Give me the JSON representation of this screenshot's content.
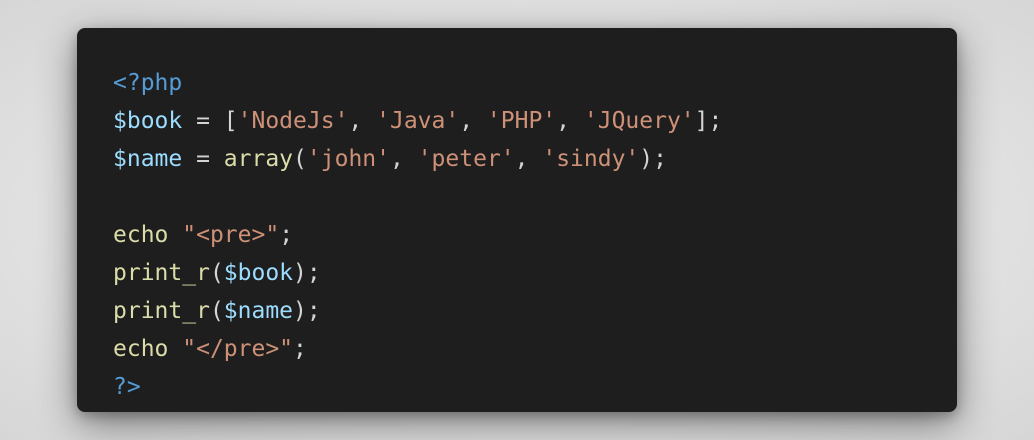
{
  "code": {
    "lines": [
      [
        {
          "t": "<?php",
          "k": "tag"
        }
      ],
      [
        {
          "t": "$book",
          "k": "var"
        },
        {
          "t": " = [",
          "k": "punc"
        },
        {
          "t": "'NodeJs'",
          "k": "str"
        },
        {
          "t": ", ",
          "k": "punc"
        },
        {
          "t": "'Java'",
          "k": "str"
        },
        {
          "t": ", ",
          "k": "punc"
        },
        {
          "t": "'PHP'",
          "k": "str"
        },
        {
          "t": ", ",
          "k": "punc"
        },
        {
          "t": "'JQuery'",
          "k": "str"
        },
        {
          "t": "];",
          "k": "punc"
        }
      ],
      [
        {
          "t": "$name",
          "k": "var"
        },
        {
          "t": " = ",
          "k": "punc"
        },
        {
          "t": "array",
          "k": "fn"
        },
        {
          "t": "(",
          "k": "punc"
        },
        {
          "t": "'john'",
          "k": "str"
        },
        {
          "t": ", ",
          "k": "punc"
        },
        {
          "t": "'peter'",
          "k": "str"
        },
        {
          "t": ", ",
          "k": "punc"
        },
        {
          "t": "'sindy'",
          "k": "str"
        },
        {
          "t": ");",
          "k": "punc"
        }
      ],
      [],
      [
        {
          "t": "echo",
          "k": "fn"
        },
        {
          "t": " ",
          "k": "punc"
        },
        {
          "t": "\"<pre>\"",
          "k": "str"
        },
        {
          "t": ";",
          "k": "punc"
        }
      ],
      [
        {
          "t": "print_r",
          "k": "fn"
        },
        {
          "t": "(",
          "k": "punc"
        },
        {
          "t": "$book",
          "k": "var"
        },
        {
          "t": ");",
          "k": "punc"
        }
      ],
      [
        {
          "t": "print_r",
          "k": "fn"
        },
        {
          "t": "(",
          "k": "punc"
        },
        {
          "t": "$name",
          "k": "var"
        },
        {
          "t": ");",
          "k": "punc"
        }
      ],
      [
        {
          "t": "echo",
          "k": "fn"
        },
        {
          "t": " ",
          "k": "punc"
        },
        {
          "t": "\"</pre>\"",
          "k": "str"
        },
        {
          "t": ";",
          "k": "punc"
        }
      ],
      [
        {
          "t": "?>",
          "k": "tag"
        }
      ]
    ]
  },
  "colors": {
    "background": "#1e1e1e",
    "tag": "#569cd6",
    "variable": "#9cdcfe",
    "string": "#ce9178",
    "function": "#dcdcaa",
    "punctuation": "#d4d4d4"
  }
}
